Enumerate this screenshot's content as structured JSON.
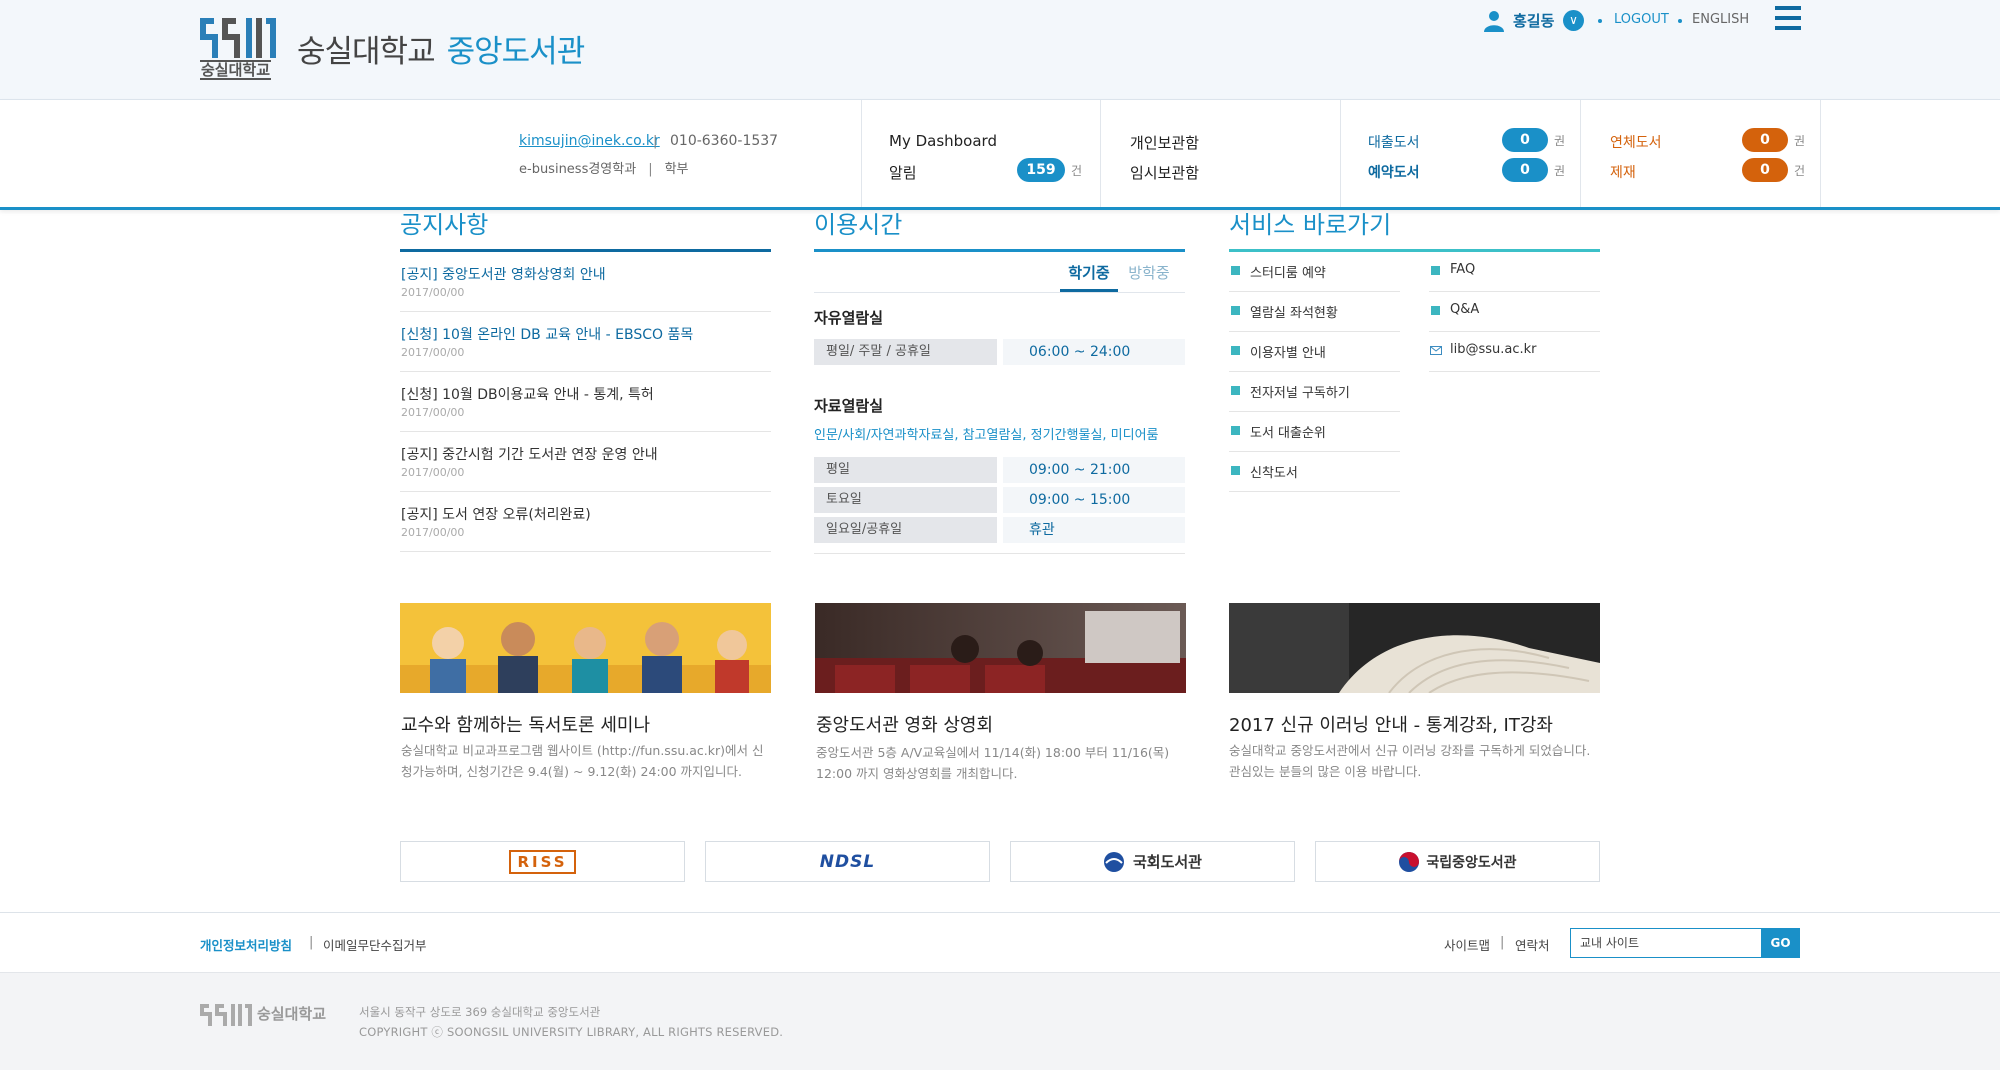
{
  "header": {
    "logo_text": "숭실대학교",
    "site_name": "숭실대학교",
    "site_name_accent": "중앙도서관",
    "user_name": "홍길동",
    "logout": "LOGOUT",
    "english": "ENGLISH"
  },
  "profile": {
    "email": "kimsujin@inek.co.kr",
    "phone": "010-6360-1537",
    "dept": "e-business경영학과",
    "level": "학부",
    "sep": "|"
  },
  "dashboard": {
    "title": "My Dashboard",
    "alarm_label": "알림",
    "alarm_count": "159",
    "count_unit": "건",
    "book_unit": "권",
    "personal_shelf": "개인보관함",
    "temp_shelf": "임시보관함",
    "loan_label": "대출도서",
    "loan_count": "0",
    "reserve_label": "예약도서",
    "reserve_count": "0",
    "overdue_label": "연체도서",
    "overdue_count": "0",
    "restrict_label": "제재",
    "restrict_count": "0"
  },
  "notices": {
    "title": "공지사항",
    "items": [
      {
        "title": "[공지] 중앙도서관 영화상영회 안내",
        "date": "2017/00/00",
        "highlight": true
      },
      {
        "title": "[신청] 10월 온라인 DB 교육 안내 - EBSCO 품목",
        "date": "2017/00/00",
        "highlight": true
      },
      {
        "title": "[신청] 10월 DB이용교육 안내 - 통계, 특허",
        "date": "2017/00/00",
        "highlight": false
      },
      {
        "title": "[공지] 중간시험 기간 도서관 연장 운영 안내",
        "date": "2017/00/00",
        "highlight": false
      },
      {
        "title": "[공지] 도서 연장 오류(처리완료)",
        "date": "2017/00/00",
        "highlight": false
      }
    ]
  },
  "hours": {
    "title": "이용시간",
    "tab_semester": "학기중",
    "tab_vacation": "방학중",
    "reading_room_title": "자유열람실",
    "reading_room_rows": [
      {
        "label": "평일/ 주말 / 공휴일",
        "value": "06:00 ~ 24:00"
      }
    ],
    "material_room_title": "자료열람실",
    "material_room_note": "인문/사회/자연과학자료실, 참고열람실, 정기간행물실, 미디어룸",
    "material_room_rows": [
      {
        "label": "평일",
        "value": "09:00 ~ 21:00"
      },
      {
        "label": "토요일",
        "value": "09:00 ~ 15:00"
      },
      {
        "label": "일요일/공휴일",
        "value": "휴관"
      }
    ]
  },
  "services": {
    "title": "서비스 바로가기",
    "left": [
      "스터디룸 예약",
      "열람실 좌석현황",
      "이용자별 안내",
      "전자저널 구독하기",
      "도서 대출순위",
      "신착도서"
    ],
    "right": [
      "FAQ",
      "Q&A",
      "lib@ssu.ac.kr"
    ]
  },
  "cards": [
    {
      "title": "교수와 함께하는 독서토론 세미나",
      "desc": "숭실대학교 비교과프로그램 웹사이트 (http://fun.ssu.ac.kr)에서 신청가능하며, 신청기간은 9.4(월) ~ 9.12(화) 24:00 까지입니다."
    },
    {
      "title": "중앙도서관 영화 상영회",
      "desc": "중앙도서관 5층 A/V교육실에서 11/14(화) 18:00 부터 11/16(목) 12:00 까지 영화상영회를 개최합니다."
    },
    {
      "title": "2017 신규 이러닝 안내 - 통계강좌, IT강좌",
      "desc": "숭실대학교 중앙도서관에서 신규 이러닝 강좌를 구독하게 되었습니다. 관심있는 분들의 많은 이용 바랍니다."
    }
  ],
  "partners": [
    "RISS",
    "NDSL",
    "국회도서관",
    "국립중앙도서관"
  ],
  "footer": {
    "privacy": "개인정보처리방침",
    "email_refuse": "이메일무단수집거부",
    "sitemap": "사이트맵",
    "contact": "연락처",
    "search_value": "교내 사이트",
    "go": "GO",
    "logo_text": "숭실대학교",
    "address": "서울시 동작구 상도로 369  숭실대학교 중앙도서관",
    "copyright": "COPYRIGHT  ⓒ  SOONGSIL UNIVERSITY LIBRARY, ALL RIGHTS RESERVED."
  },
  "colors": {
    "primary": "#1a90c8",
    "dark_blue": "#0e6aa0",
    "teal": "#3cb6c0",
    "orange": "#d4620c"
  }
}
